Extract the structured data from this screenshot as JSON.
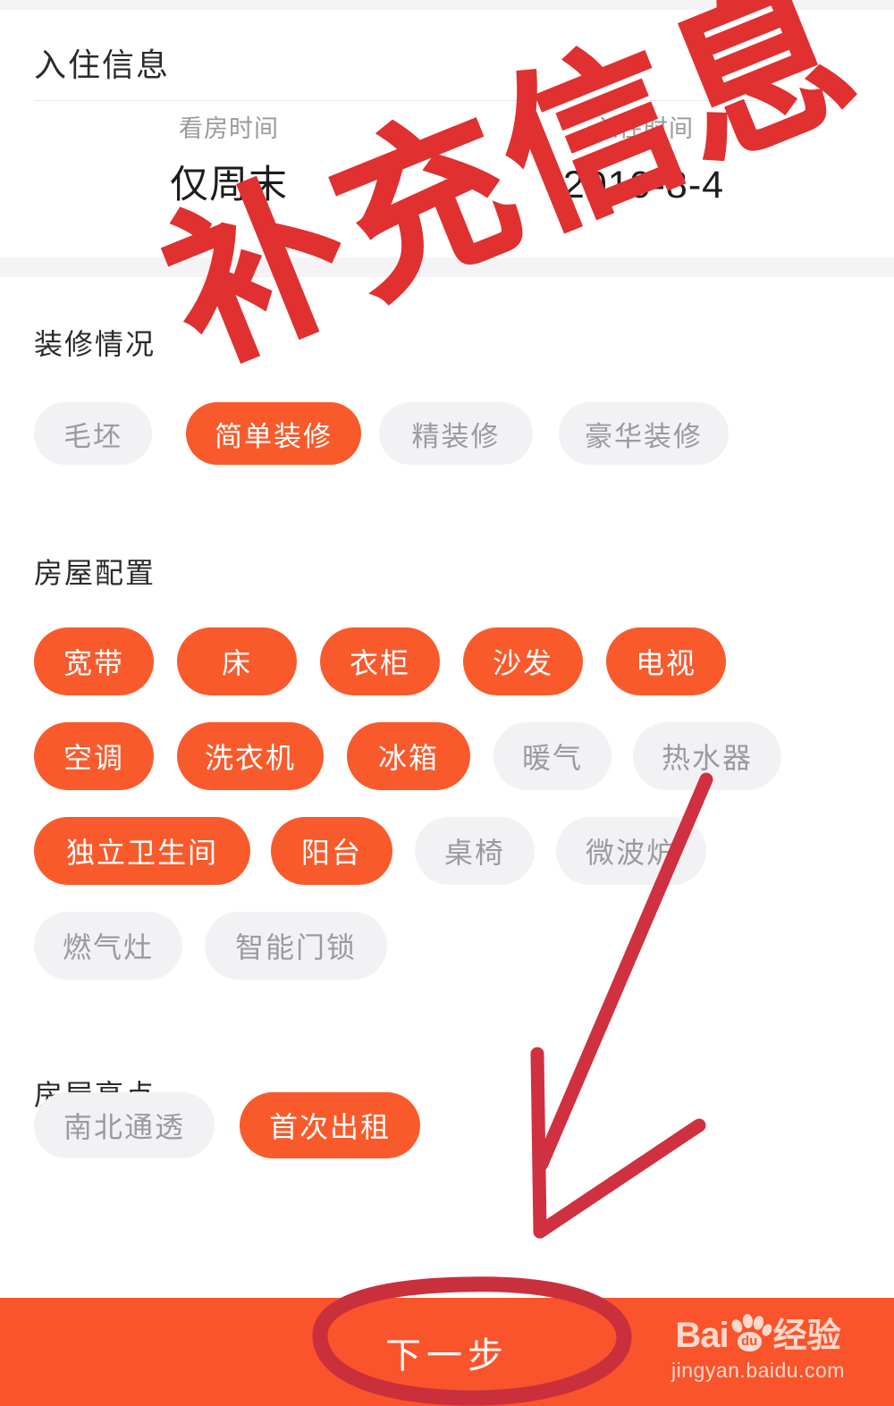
{
  "page": {
    "checkin_section": {
      "title": "入住信息",
      "fields": [
        {
          "label": "看房时间",
          "value": "仅周末"
        },
        {
          "label": "入住时间",
          "value": "2019-8-4"
        }
      ]
    },
    "decoration_section": {
      "title": "装修情况",
      "options": [
        {
          "label": "毛坯",
          "selected": false
        },
        {
          "label": "简单装修",
          "selected": true
        },
        {
          "label": "精装修",
          "selected": false
        },
        {
          "label": "豪华装修",
          "selected": false
        }
      ]
    },
    "configuration_section": {
      "title": "房屋配置",
      "options": [
        {
          "label": "宽带",
          "selected": true
        },
        {
          "label": "床",
          "selected": true
        },
        {
          "label": "衣柜",
          "selected": true
        },
        {
          "label": "沙发",
          "selected": true
        },
        {
          "label": "电视",
          "selected": true
        },
        {
          "label": "空调",
          "selected": true
        },
        {
          "label": "洗衣机",
          "selected": true
        },
        {
          "label": "冰箱",
          "selected": true
        },
        {
          "label": "暖气",
          "selected": false
        },
        {
          "label": "热水器",
          "selected": false
        },
        {
          "label": "独立卫生间",
          "selected": true
        },
        {
          "label": "阳台",
          "selected": true
        },
        {
          "label": "桌椅",
          "selected": false
        },
        {
          "label": "微波炉",
          "selected": false
        },
        {
          "label": "燃气灶",
          "selected": false
        },
        {
          "label": "智能门锁",
          "selected": false
        }
      ]
    },
    "highlights_section": {
      "title": "房屋亮点",
      "options": [
        {
          "label": "南北通透",
          "selected": false
        },
        {
          "label": "首次出租",
          "selected": true
        }
      ]
    },
    "bottom_bar": {
      "next_label": "下一步"
    },
    "watermark": {
      "brand_bai": "Bai",
      "brand_du": "du",
      "brand_jingyan": "经验",
      "url": "jingyan.baidu.com"
    },
    "annotation": {
      "handwritten_text": "补充信息",
      "color": "#e03030",
      "arrow_color": "#d0303f",
      "ellipse_color": "#c9303c"
    },
    "colors": {
      "accent_orange": "#f95a2c",
      "bottom_bar": "#f9542b",
      "tag_off_bg": "#f2f2f4",
      "tag_off_text": "#9a9aa0",
      "label_grey": "#9a9a9e",
      "title_dark": "#2b2b2b",
      "page_bg": "#ffffff",
      "band_grey": "#f4f4f6"
    }
  }
}
